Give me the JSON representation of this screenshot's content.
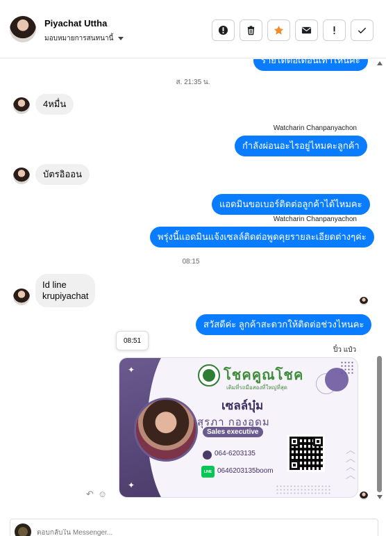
{
  "header": {
    "name": "Piyachat Uttha",
    "assign": "มอบหมายการสนทนานี้",
    "actions": [
      {
        "icon": "alert-circle-icon",
        "label": "Mark as spam"
      },
      {
        "icon": "trash-icon",
        "label": "Delete"
      },
      {
        "icon": "star-icon",
        "label": "Star"
      },
      {
        "icon": "envelope-icon",
        "label": "Mark unread"
      },
      {
        "icon": "exclamation-icon",
        "label": "Follow up"
      },
      {
        "icon": "check-icon",
        "label": "Done"
      }
    ]
  },
  "colors": {
    "outgoing": "#0a7cff",
    "incoming": "#f0f0f0",
    "accent": "#f08c2a",
    "card": "#6b5a8e"
  },
  "messages": {
    "m0": "รายได้ต่อเดือนเท่าไหนคะ",
    "time1": "ส. 21:35 น.",
    "m1": "4หมื่น",
    "sender1": "Watcharin Chanpanyachon",
    "m2": "กำลังผ่อนอะไรอยู่ไหมคะลูกค้า",
    "m3": "บัตรอิออน",
    "m4": "แอดมินขอเบอร์ติดต่อลูกค้าได้ไหมคะ",
    "sender2": "Watcharin Chanpanyachon",
    "m5": "พรุ่งนี้แอดมินแจ้งเซลล์ติดต่อพูดคุยรายละเอียดต่างๆค่ะ",
    "time2": "08:15",
    "m6a": "Id line",
    "m6b": "krupiyachat",
    "m7": "สวัสดีค่ะ ลูกค้าสะดวกให้ติดต่อช่วงไหนคะ",
    "tooltip_time": "08:51",
    "seen_by": "ปิ๋ว แป๋ว"
  },
  "card": {
    "brand": "โชคคูณโชค",
    "tagline": "เติมที่รถมือสองที่ใหญ่ที่สุด",
    "nickname": "เซลล์บุ๋ม",
    "fullname": "สุรภา   กองอุดม",
    "title": "Sales executive",
    "phone": "064-6203135",
    "line_badge": "LINE",
    "line_id": "0646203135boom"
  },
  "composer": {
    "placeholder": "ตอบกลับใน Messenger..."
  }
}
